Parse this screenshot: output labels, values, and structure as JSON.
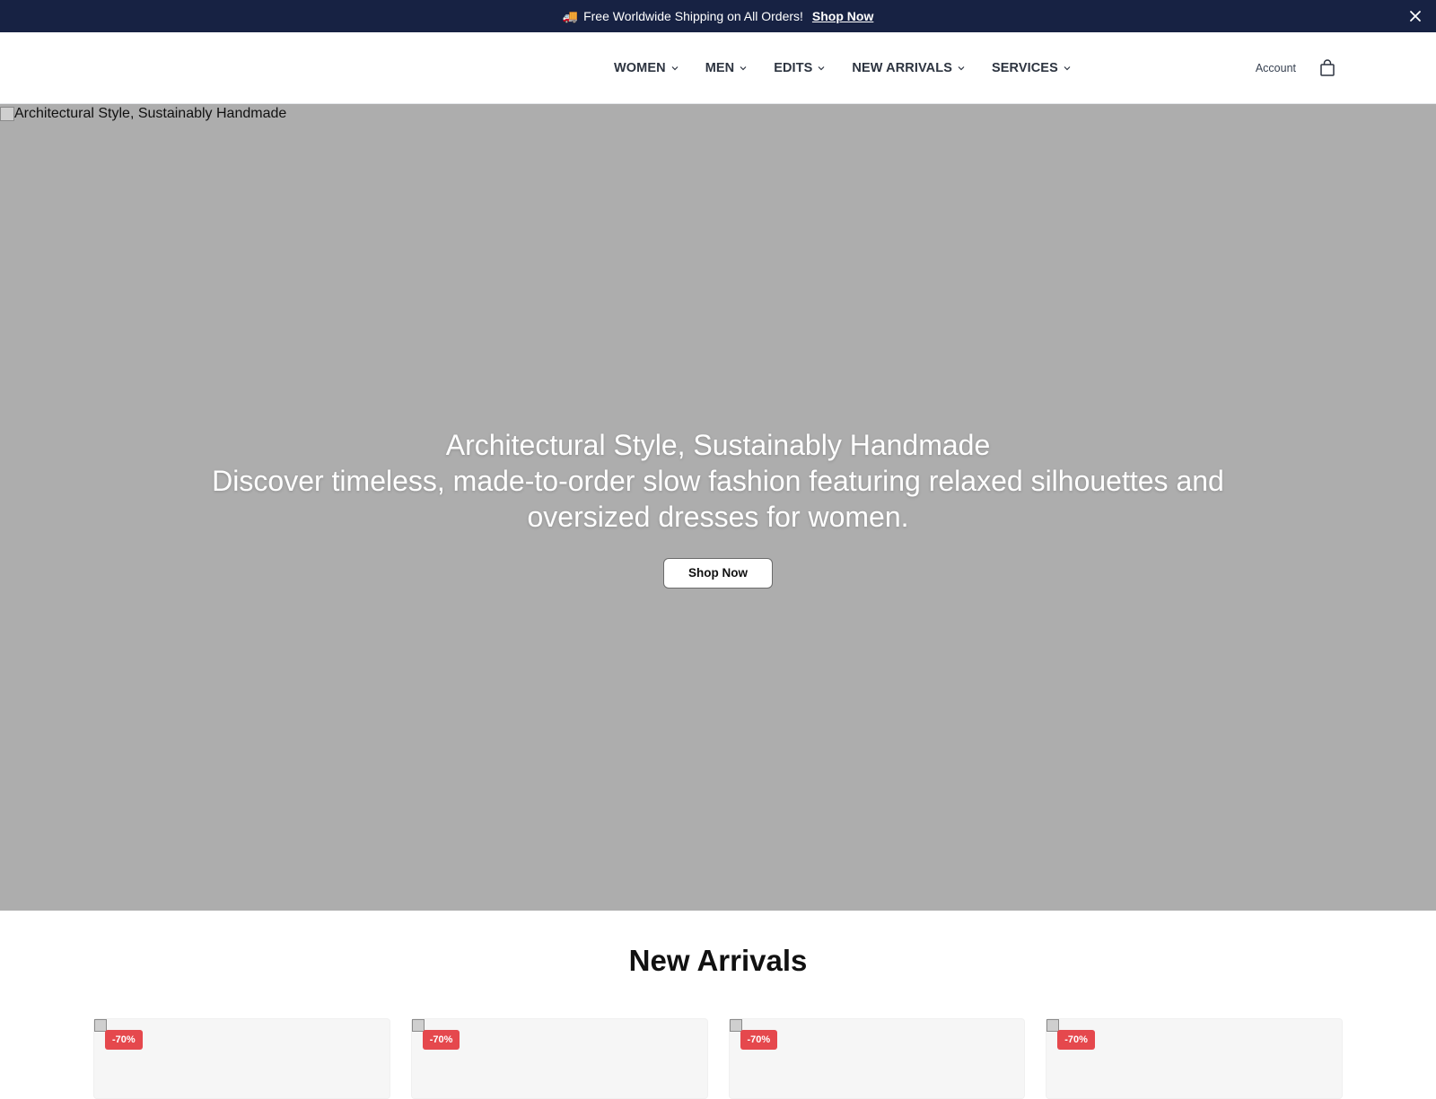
{
  "announcement": {
    "truck_emoji": "🚚",
    "message": "Free Worldwide Shipping on All Orders!",
    "link_label": "Shop Now"
  },
  "nav": {
    "items": [
      {
        "label": "WOMEN"
      },
      {
        "label": "MEN"
      },
      {
        "label": "EDITS"
      },
      {
        "label": "NEW ARRIVALS"
      },
      {
        "label": "SERVICES"
      }
    ]
  },
  "header": {
    "account_label": "Account"
  },
  "hero": {
    "image_alt": "Architectural Style, Sustainably Handmade",
    "title": "Architectural Style, Sustainably Handmade",
    "subtitle": "Discover timeless, made-to-order slow fashion featuring relaxed silhouettes and oversized dresses for women.",
    "cta_label": "Shop Now"
  },
  "new_arrivals": {
    "title": "New Arrivals",
    "products": [
      {
        "badge": "-70%"
      },
      {
        "badge": "-70%"
      },
      {
        "badge": "-70%"
      },
      {
        "badge": "-70%"
      }
    ]
  },
  "colors": {
    "announcement_bg": "#172243",
    "hero_bg": "#adadad",
    "badge_bg": "#e5484d"
  }
}
